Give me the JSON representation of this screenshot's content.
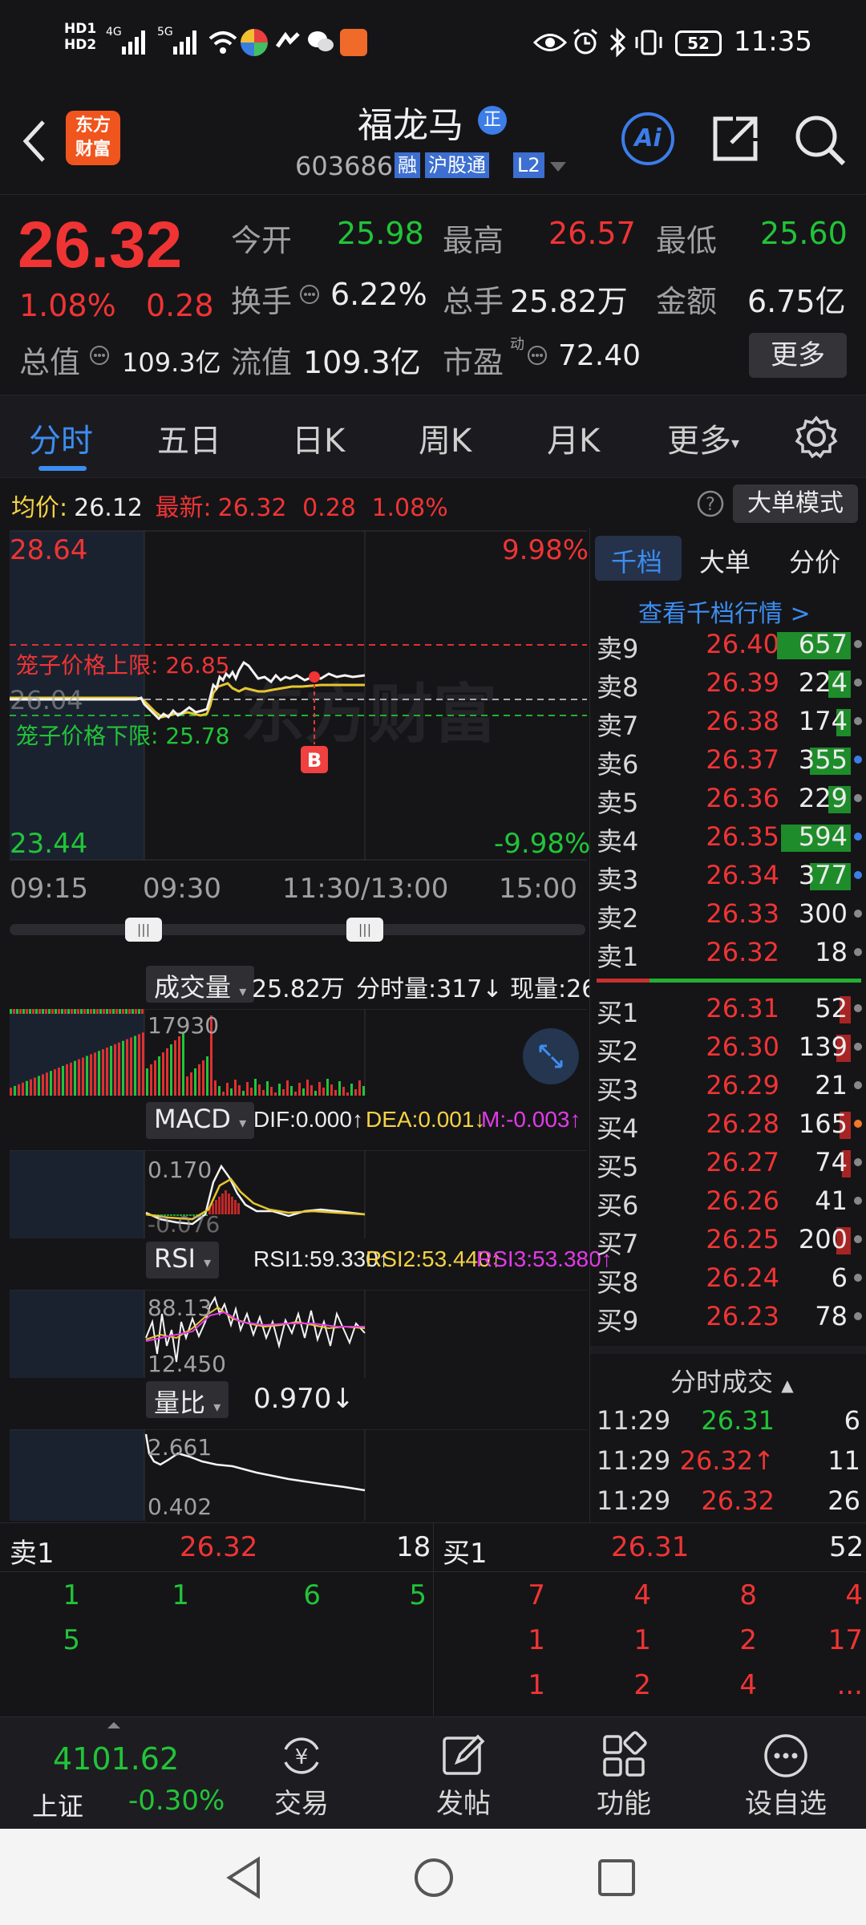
{
  "status": {
    "time": "11:35",
    "battery": "52",
    "network_left": [
      "HD1",
      "HD2",
      "4G",
      "5G"
    ]
  },
  "header": {
    "logo_line1": "东方",
    "logo_line2": "财富",
    "stock_name": "福龙马",
    "badge": "正",
    "code": "603686",
    "tag_rong": "融",
    "tag_hgt": "沪股通",
    "tag_l2": "L2",
    "ai_label": "Ai"
  },
  "quote": {
    "price": "26.32",
    "change_pct": "1.08%",
    "change": "0.28",
    "open_label": "今开",
    "open": "25.98",
    "high_label": "最高",
    "high": "26.57",
    "low_label": "最低",
    "low": "25.60",
    "turnover_label": "换手",
    "turnover": "6.22%",
    "volume_label": "总手",
    "volume": "25.82万",
    "amount_label": "金额",
    "amount": "6.75亿",
    "mktcap_label": "总值",
    "mktcap": "109.3亿",
    "float_label": "流值",
    "float": "109.3亿",
    "pe_label": "市盈",
    "pe_sup": "动",
    "pe": "72.40",
    "more_button": "更多"
  },
  "tabs": [
    "分时",
    "五日",
    "日K",
    "周K",
    "月K",
    "更多"
  ],
  "avgbar": {
    "avg_label": "均价:",
    "avg": "26.12",
    "latest_label": "最新:",
    "latest": "26.32",
    "change": "0.28",
    "change_pct": "1.08%",
    "mode_button": "大单模式"
  },
  "chart_meta": {
    "y_top": "28.64",
    "y_top_pct": "9.98%",
    "y_bottom": "23.44",
    "y_bottom_pct": "-9.98%",
    "y_mid": "26.04",
    "upper_cage": "笼子价格上限: 26.85",
    "lower_cage": "笼子价格下限: 25.78",
    "watermark": "东方财富",
    "marker": "B",
    "x_labels": [
      "09:15",
      "09:30",
      "11:30/13:00",
      "15:00"
    ]
  },
  "volume_panel": {
    "selector": "成交量",
    "total": "25.82万",
    "fenshi_label": "分时量:317↓",
    "xianliang_label": "现量:26",
    "max_label": "17930"
  },
  "macd_panel": {
    "selector": "MACD",
    "dif": "DIF:0.000↑",
    "dea": "DEA:0.001↓",
    "m": "M:-0.003↑",
    "top": "0.170",
    "bottom": "-0.076"
  },
  "rsi_panel": {
    "selector": "RSI",
    "rsi1": "RSI1:59.330↑",
    "rsi2": "RSI2:53.440↑",
    "rsi3": "RSI3:53.380↑",
    "top": "88.13",
    "bottom": "12.450"
  },
  "lb_panel": {
    "selector": "量比",
    "value": "0.970↓",
    "top": "2.661",
    "bottom": "0.402"
  },
  "book": {
    "tabs": [
      "千档",
      "大单",
      "分价"
    ],
    "link": "查看千档行情 >",
    "asks": [
      {
        "label": "卖9",
        "price": "26.40",
        "vol": "657",
        "bar": 1.0,
        "dot": "#888888"
      },
      {
        "label": "卖8",
        "price": "26.39",
        "vol": "224",
        "bar": 0.3,
        "dot": "#888888"
      },
      {
        "label": "卖7",
        "price": "26.38",
        "vol": "174",
        "bar": 0.2,
        "dot": "#888888"
      },
      {
        "label": "卖6",
        "price": "26.37",
        "vol": "355",
        "bar": 0.55,
        "dot": "#3c7de8"
      },
      {
        "label": "卖5",
        "price": "26.36",
        "vol": "229",
        "bar": 0.3,
        "dot": "#888888"
      },
      {
        "label": "卖4",
        "price": "26.35",
        "vol": "594",
        "bar": 0.95,
        "dot": "#3c7de8"
      },
      {
        "label": "卖3",
        "price": "26.34",
        "vol": "377",
        "bar": 0.55,
        "dot": "#3c7de8"
      },
      {
        "label": "卖2",
        "price": "26.33",
        "vol": "300",
        "bar": 0.0,
        "dot": "#888888"
      },
      {
        "label": "卖1",
        "price": "26.32",
        "vol": "18",
        "bar": 0.0,
        "dot": "#888888"
      }
    ],
    "bids": [
      {
        "label": "买1",
        "price": "26.31",
        "vol": "52",
        "bar": 0.15,
        "dot": "#888888"
      },
      {
        "label": "买2",
        "price": "26.30",
        "vol": "139",
        "bar": 0.2,
        "dot": "#888888"
      },
      {
        "label": "买3",
        "price": "26.29",
        "vol": "21",
        "bar": 0.0,
        "dot": "#888888"
      },
      {
        "label": "买4",
        "price": "26.28",
        "vol": "165",
        "bar": 0.15,
        "dot": "#f07a2a"
      },
      {
        "label": "买5",
        "price": "26.27",
        "vol": "74",
        "bar": 0.12,
        "dot": "#888888"
      },
      {
        "label": "买6",
        "price": "26.26",
        "vol": "41",
        "bar": 0.0,
        "dot": "#888888"
      },
      {
        "label": "买7",
        "price": "26.25",
        "vol": "200",
        "bar": 0.2,
        "dot": "#888888"
      },
      {
        "label": "买8",
        "price": "26.24",
        "vol": "6",
        "bar": 0.0,
        "dot": "#888888"
      },
      {
        "label": "买9",
        "price": "26.23",
        "vol": "78",
        "bar": 0.0,
        "dot": "#888888"
      }
    ],
    "trades_title": "分时成交",
    "trades": [
      {
        "time": "11:29",
        "price": "26.31",
        "vol": "6",
        "pc": "green",
        "vc": "green"
      },
      {
        "time": "11:29",
        "price": "26.32↑",
        "vol": "11",
        "pc": "red",
        "vc": "red"
      },
      {
        "time": "11:29",
        "price": "26.32",
        "vol": "26",
        "pc": "red",
        "vc": "red"
      }
    ]
  },
  "level1": {
    "sell_label": "卖1",
    "sell_price": "26.32",
    "sell_vol": "18",
    "buy_label": "买1",
    "buy_price": "26.31",
    "buy_vol": "52",
    "sell_queue": [
      [
        "1",
        "1",
        "6",
        "5"
      ],
      [
        "5",
        "",
        "",
        ""
      ]
    ],
    "buy_queue": [
      [
        "7",
        "4",
        "8",
        "4"
      ],
      [
        "1",
        "1",
        "2",
        "17"
      ],
      [
        "1",
        "2",
        "4",
        "..."
      ]
    ]
  },
  "bottomnav": {
    "index_value": "4101.62",
    "index_name": "上证",
    "index_change": "-0.30%",
    "items": [
      "交易",
      "发帖",
      "功能",
      "设自选"
    ]
  }
}
